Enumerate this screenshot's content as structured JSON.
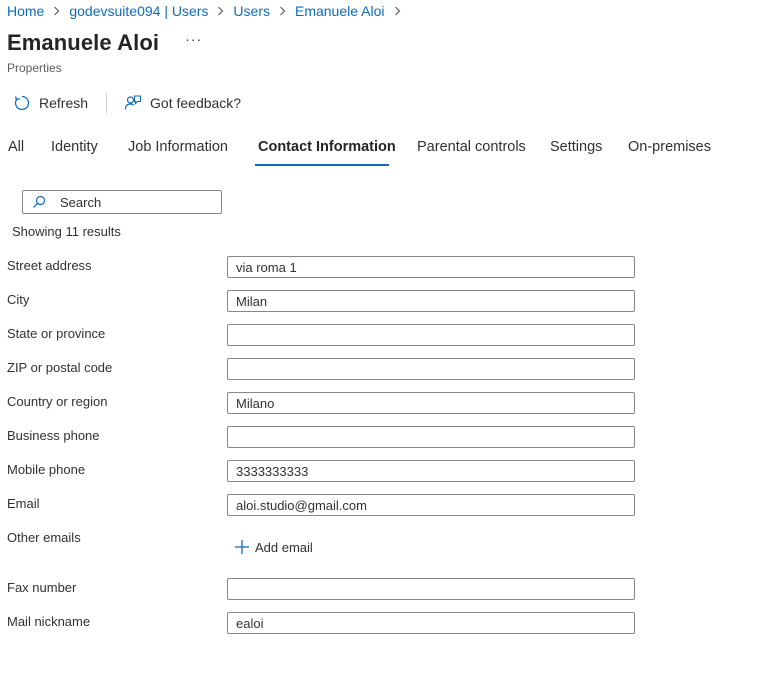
{
  "breadcrumb": [
    "Home",
    "godevsuite094 | Users",
    "Users",
    "Emanuele Aloi"
  ],
  "header": {
    "title": "Emanuele Aloi",
    "more": "···",
    "subtitle": "Properties"
  },
  "toolbar": {
    "refresh": "Refresh",
    "feedback": "Got feedback?"
  },
  "tabs": [
    "All",
    "Identity",
    "Job Information",
    "Contact Information",
    "Parental controls",
    "Settings",
    "On-premises"
  ],
  "active_tab": "Contact Information",
  "search": {
    "placeholder": "Search",
    "results": "Showing 11 results"
  },
  "fields": [
    {
      "label": "Street address",
      "value": "via roma 1"
    },
    {
      "label": "City",
      "value": "Milan"
    },
    {
      "label": "State or province",
      "value": ""
    },
    {
      "label": "ZIP or postal code",
      "value": ""
    },
    {
      "label": "Country or region",
      "value": "Milano"
    },
    {
      "label": "Business phone",
      "value": ""
    },
    {
      "label": "Mobile phone",
      "value": "3333333333"
    },
    {
      "label": "Email",
      "value": "aloi.studio@gmail.com"
    },
    {
      "label": "Other emails",
      "action": "Add email"
    },
    {
      "label": "Fax number",
      "value": ""
    },
    {
      "label": "Mail nickname",
      "value": "ealoi"
    }
  ],
  "icons": {
    "refresh": "refresh-icon",
    "feedback": "feedback-icon",
    "search": "search-icon",
    "add": "plus-icon",
    "separator": "chevron-right-icon"
  },
  "colors": {
    "link": "#0f6cbd",
    "accent": "#0f6cbd",
    "text": "#323130",
    "border": "#8a8886"
  }
}
